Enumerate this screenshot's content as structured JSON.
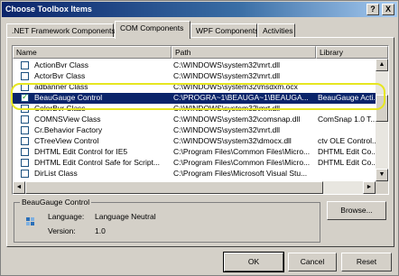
{
  "window": {
    "title": "Choose Toolbox Items"
  },
  "titlebar_buttons": {
    "help": "?",
    "close": "X"
  },
  "tabs": [
    {
      "label": ".NET Framework Components"
    },
    {
      "label": "COM Components"
    },
    {
      "label": "WPF Components"
    },
    {
      "label": "Activities"
    }
  ],
  "columns": {
    "name": "Name",
    "path": "Path",
    "library": "Library"
  },
  "rows": [
    {
      "checked": false,
      "name": "ActionBvr Class",
      "path": "C:\\WINDOWS\\system32\\mrt.dll",
      "library": ""
    },
    {
      "checked": false,
      "name": "ActorBvr Class",
      "path": "C:\\WINDOWS\\system32\\mrt.dll",
      "library": ""
    },
    {
      "checked": false,
      "name": "adbanner Class",
      "path": "C:\\WINDOWS\\system32\\msdxm.ocx",
      "library": ""
    },
    {
      "checked": true,
      "selected": true,
      "name": "BeauGauge Control",
      "path": "C:\\PROGRA~1\\BEAUGA~1\\BEAUGA...",
      "library": "BeauGauge Acti..."
    },
    {
      "checked": false,
      "name": "ColorBvr Class",
      "path": "C:\\WINDOWS\\system32\\mrt.dll",
      "library": ""
    },
    {
      "checked": false,
      "name": "COMNSView Class",
      "path": "C:\\WINDOWS\\system32\\comsnap.dll",
      "library": "ComSnap 1.0 T..."
    },
    {
      "checked": false,
      "name": "Cr.Behavior Factory",
      "path": "C:\\WINDOWS\\system32\\mrt.dll",
      "library": ""
    },
    {
      "checked": false,
      "name": "CTreeView Control",
      "path": "C:\\WINDOWS\\system32\\dmocx.dll",
      "library": "ctv OLE Control..."
    },
    {
      "checked": false,
      "name": "DHTML Edit Control for IE5",
      "path": "C:\\Program Files\\Common Files\\Micro...",
      "library": "DHTML Edit Co..."
    },
    {
      "checked": false,
      "name": "DHTML Edit Control Safe for Script...",
      "path": "C:\\Program Files\\Common Files\\Micro...",
      "library": "DHTML Edit Co..."
    },
    {
      "checked": false,
      "name": "DirList Class",
      "path": "C:\\Program Files\\Microsoft Visual Stu...",
      "library": ""
    }
  ],
  "details": {
    "group_title": "BeauGauge Control",
    "language_label": "Language:",
    "language_value": "Language Neutral",
    "version_label": "Version:",
    "version_value": "1.0"
  },
  "buttons": {
    "browse": "Browse...",
    "ok": "OK",
    "cancel": "Cancel",
    "reset": "Reset"
  },
  "scroll": {
    "up": "▲",
    "down": "▼",
    "left": "◄",
    "right": "►"
  },
  "colors": {
    "selection": "#0a246a",
    "highlight_ring": "#e6e621",
    "checkmark": "#21a121"
  }
}
